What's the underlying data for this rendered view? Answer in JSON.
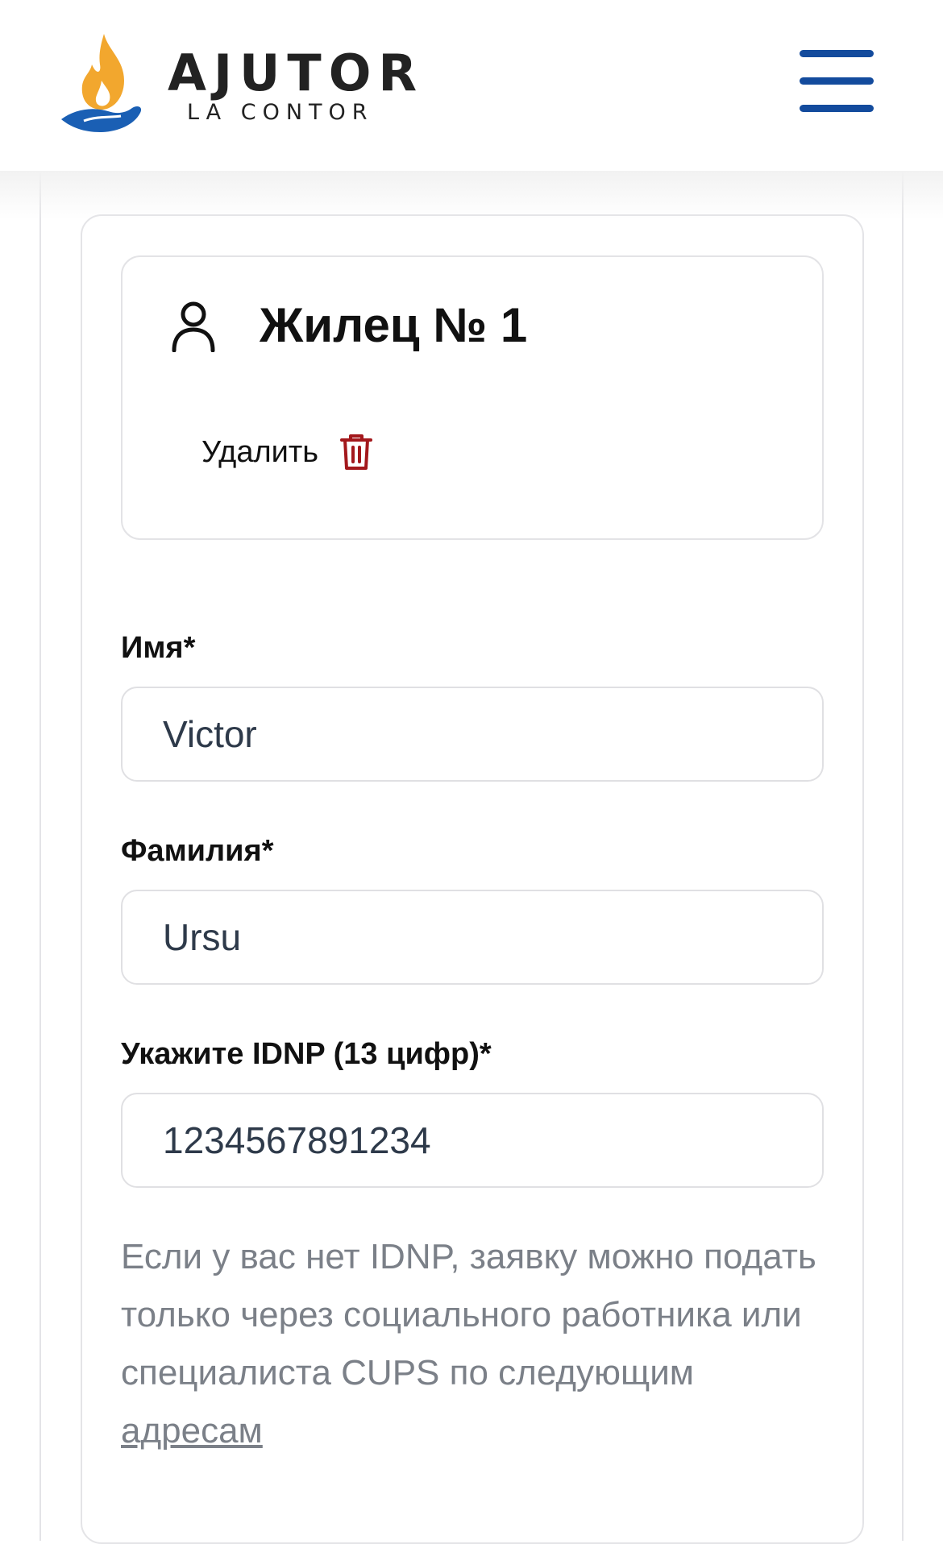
{
  "header": {
    "brand_title": "AJUTOR",
    "brand_subtitle": "LA CONTOR",
    "logo_icon": "flame-hand-logo",
    "menu_icon": "hamburger-menu-icon",
    "accent_color": "#134b9d",
    "flame_color": "#f2a72e"
  },
  "resident": {
    "title": "Жилец № 1",
    "icon": "user-icon",
    "delete_label": "Удалить",
    "delete_icon": "trash-icon",
    "delete_color": "#a3181c"
  },
  "form": {
    "first_name": {
      "label": "Имя*",
      "value": "Victor"
    },
    "last_name": {
      "label": "Фамилия*",
      "value": "Ursu"
    },
    "idnp": {
      "label": "Укажите IDNP (13 цифр)*",
      "value": "1234567891234"
    }
  },
  "hint": {
    "text": "Если у вас нет IDNP, заявку можно подать только через социального работника или специалиста CUPS по следующим ",
    "link_text": "адресам"
  }
}
